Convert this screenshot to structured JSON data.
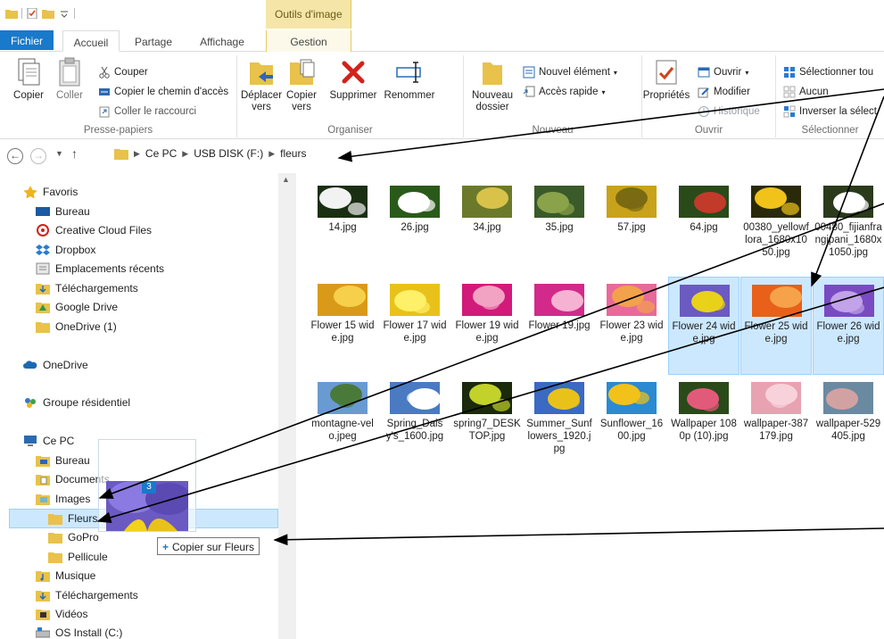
{
  "titlebar": {
    "context_tab": "Outils d'image"
  },
  "tabs": {
    "file": "Fichier",
    "home": "Accueil",
    "share": "Partage",
    "view": "Affichage",
    "manage": "Gestion"
  },
  "ribbon": {
    "clipboard": {
      "label": "Presse-papiers",
      "copy": "Copier",
      "paste": "Coller",
      "cut": "Couper",
      "copy_path": "Copier le chemin d'accès",
      "paste_shortcut": "Coller le raccourci"
    },
    "organize": {
      "label": "Organiser",
      "move_to": "Déplacer vers",
      "copy_to": "Copier vers",
      "delete": "Supprimer",
      "rename": "Renommer"
    },
    "new": {
      "label": "Nouveau",
      "new_folder": "Nouveau dossier",
      "new_item": "Nouvel élément",
      "easy_access": "Accès rapide"
    },
    "open": {
      "label": "Ouvrir",
      "properties": "Propriétés",
      "open": "Ouvrir",
      "edit": "Modifier",
      "history": "Historique"
    },
    "select": {
      "label": "Sélectionner",
      "select_all": "Sélectionner tou",
      "select_none": "Aucun",
      "invert": "Inverser la sélect"
    }
  },
  "address": {
    "crumbs": [
      "Ce PC",
      "USB DISK (F:)",
      "fleurs"
    ]
  },
  "nav": {
    "favorites": "Favoris",
    "fav_items": [
      "Bureau",
      "Creative Cloud Files",
      "Dropbox",
      "Emplacements récents",
      "Téléchargements",
      "Google Drive",
      "OneDrive (1)"
    ],
    "onedrive": "OneDrive",
    "homegroup": "Groupe résidentiel",
    "thispc": "Ce PC",
    "pc_items": [
      "Bureau",
      "Documents",
      "Images",
      "Fleurs",
      "GoPro",
      "Pellicule",
      "Musique",
      "Téléchargements",
      "Vidéos",
      "OS Install (C:)"
    ]
  },
  "drag": {
    "count": "3",
    "tooltip": "Copier sur Fleurs"
  },
  "files": [
    {
      "name": "14.jpg",
      "c1": "#1a2f12",
      "c2": "#f2f2f2",
      "selected": false
    },
    {
      "name": "26.jpg",
      "c1": "#2a5a1a",
      "c2": "#ffffff",
      "selected": false
    },
    {
      "name": "34.jpg",
      "c1": "#6b7a2a",
      "c2": "#d9c24a",
      "selected": false
    },
    {
      "name": "35.jpg",
      "c1": "#3a5a2a",
      "c2": "#8aa34a",
      "selected": false
    },
    {
      "name": "57.jpg",
      "c1": "#c8a21a",
      "c2": "#7a6a12",
      "selected": false
    },
    {
      "name": "64.jpg",
      "c1": "#2a4a1a",
      "c2": "#c23a2a",
      "selected": false
    },
    {
      "name": "00380_yellowflora_1680x1050.jpg",
      "c1": "#2a2a0a",
      "c2": "#f0c21a",
      "selected": false
    },
    {
      "name": "00480_fijianfrangipani_1680x1050.jpg",
      "c1": "#2a3a1a",
      "c2": "#ffffff",
      "selected": false
    },
    {
      "name": "Flower 15 wide.jpg",
      "c1": "#d99a1a",
      "c2": "#f6d04a",
      "selected": false
    },
    {
      "name": "Flower 17 wide.jpg",
      "c1": "#e8c21a",
      "c2": "#fff06a",
      "selected": false
    },
    {
      "name": "Flower 19 wide.jpg",
      "c1": "#d21a7a",
      "c2": "#f2a2c2",
      "selected": false
    },
    {
      "name": "Flower 19.jpg",
      "c1": "#d22a8a",
      "c2": "#f5b2d2",
      "selected": false
    },
    {
      "name": "Flower 23 wide.jpg",
      "c1": "#e86a9a",
      "c2": "#f2a24a",
      "selected": false
    },
    {
      "name": "Flower 24 wide.jpg",
      "c1": "#6a5ac2",
      "c2": "#e8d21a",
      "selected": true
    },
    {
      "name": "Flower 25 wide.jpg",
      "c1": "#e8601a",
      "c2": "#f6a24a",
      "selected": true
    },
    {
      "name": "Flower 26 wide.jpg",
      "c1": "#7a4ac2",
      "c2": "#c2a2e8",
      "selected": true
    },
    {
      "name": "montagne-velo.jpeg",
      "c1": "#6a9ad2",
      "c2": "#4a7a3a",
      "selected": false
    },
    {
      "name": "Spring_Daisy's_1600.jpg",
      "c1": "#4a7ac2",
      "c2": "#ffffff",
      "selected": false
    },
    {
      "name": "spring7_DESKTOP.jpg",
      "c1": "#1a2a0a",
      "c2": "#c2d22a",
      "selected": false
    },
    {
      "name": "Summer_Sunflowers_1920.jpg",
      "c1": "#3a6ac2",
      "c2": "#e8c21a",
      "selected": false
    },
    {
      "name": "Sunflower_1600.jpg",
      "c1": "#2a8ad2",
      "c2": "#f2c21a",
      "selected": false
    },
    {
      "name": "Wallpaper 1080p (10).jpg",
      "c1": "#2a4a1a",
      "c2": "#e25a7a",
      "selected": false
    },
    {
      "name": "wallpaper-387179.jpg",
      "c1": "#e8a2b2",
      "c2": "#f8d2da",
      "selected": false
    },
    {
      "name": "wallpaper-529405.jpg",
      "c1": "#6a8aa2",
      "c2": "#d2a2a2",
      "selected": false
    }
  ]
}
